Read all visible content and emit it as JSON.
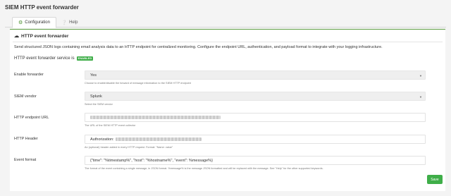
{
  "page": {
    "title": "SIEM HTTP event forwarder"
  },
  "tabs": [
    {
      "label": "Configuration",
      "icon": "gear-icon",
      "active": true
    },
    {
      "label": "Help",
      "icon": "help-circle-icon",
      "active": false
    }
  ],
  "panel": {
    "title": "HTTP event forwarder",
    "icon": "cloud-upload-icon",
    "intro": "Send structured JSON logs containing email analysis data to an HTTP endpoint for centralized monitoring. Configure the endpoint URL, authentication, and payload format to integrate with your logging infrastructure.",
    "service_label": "HTTP event forwarder service is",
    "service_badge": "ENABLED"
  },
  "form": {
    "enable_forwarder": {
      "label": "Enable forwarder",
      "value": "Yes",
      "help": "Choose to enable/disable the forward of message information to the SIEM HTTP endpoint"
    },
    "siem_vendor": {
      "label": "SIEM vendor",
      "value": "Splunk",
      "help": "Select the SIEM vendor"
    },
    "endpoint_url": {
      "label": "HTTP endpoint URL",
      "value": "",
      "help": "The URL of the SIEM HTTP event collector"
    },
    "http_header": {
      "label": "HTTP Header",
      "value": "Authorization:",
      "help": "An (optional) header added in every HTTP request. Format: \"Name: value\""
    },
    "event_format": {
      "label": "Event format",
      "value": "{\"time\": \"%timestamp%\", \"host\": \"%hostname%\", \"event\": %message%}",
      "help": "The format of the event containing a single message, in JSON format. %message% is the message JSON formatted and will be replaced with the message. See \"Help\" for the other supported keywords."
    }
  },
  "actions": {
    "save_label": "Save"
  },
  "colors": {
    "accent": "#3fae49",
    "panel_border": "#5e9e42"
  }
}
